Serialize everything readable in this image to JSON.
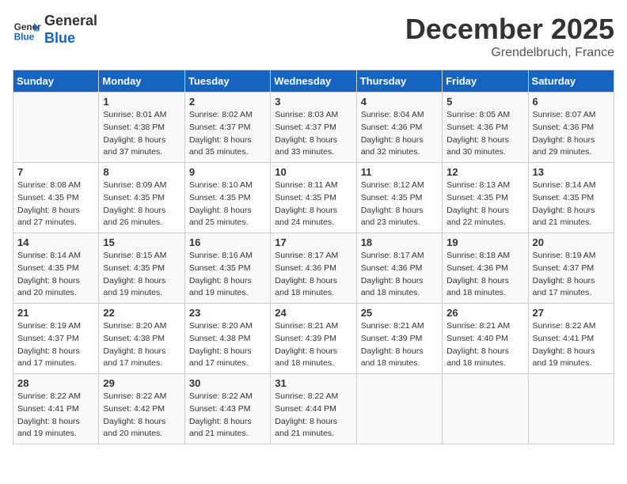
{
  "header": {
    "logo_line1": "General",
    "logo_line2": "Blue",
    "month": "December 2025",
    "location": "Grendelbruch, France"
  },
  "weekdays": [
    "Sunday",
    "Monday",
    "Tuesday",
    "Wednesday",
    "Thursday",
    "Friday",
    "Saturday"
  ],
  "weeks": [
    [
      {
        "day": "",
        "info": ""
      },
      {
        "day": "1",
        "info": "Sunrise: 8:01 AM\nSunset: 4:38 PM\nDaylight: 8 hours\nand 37 minutes."
      },
      {
        "day": "2",
        "info": "Sunrise: 8:02 AM\nSunset: 4:37 PM\nDaylight: 8 hours\nand 35 minutes."
      },
      {
        "day": "3",
        "info": "Sunrise: 8:03 AM\nSunset: 4:37 PM\nDaylight: 8 hours\nand 33 minutes."
      },
      {
        "day": "4",
        "info": "Sunrise: 8:04 AM\nSunset: 4:36 PM\nDaylight: 8 hours\nand 32 minutes."
      },
      {
        "day": "5",
        "info": "Sunrise: 8:05 AM\nSunset: 4:36 PM\nDaylight: 8 hours\nand 30 minutes."
      },
      {
        "day": "6",
        "info": "Sunrise: 8:07 AM\nSunset: 4:36 PM\nDaylight: 8 hours\nand 29 minutes."
      }
    ],
    [
      {
        "day": "7",
        "info": "Sunrise: 8:08 AM\nSunset: 4:35 PM\nDaylight: 8 hours\nand 27 minutes."
      },
      {
        "day": "8",
        "info": "Sunrise: 8:09 AM\nSunset: 4:35 PM\nDaylight: 8 hours\nand 26 minutes."
      },
      {
        "day": "9",
        "info": "Sunrise: 8:10 AM\nSunset: 4:35 PM\nDaylight: 8 hours\nand 25 minutes."
      },
      {
        "day": "10",
        "info": "Sunrise: 8:11 AM\nSunset: 4:35 PM\nDaylight: 8 hours\nand 24 minutes."
      },
      {
        "day": "11",
        "info": "Sunrise: 8:12 AM\nSunset: 4:35 PM\nDaylight: 8 hours\nand 23 minutes."
      },
      {
        "day": "12",
        "info": "Sunrise: 8:13 AM\nSunset: 4:35 PM\nDaylight: 8 hours\nand 22 minutes."
      },
      {
        "day": "13",
        "info": "Sunrise: 8:14 AM\nSunset: 4:35 PM\nDaylight: 8 hours\nand 21 minutes."
      }
    ],
    [
      {
        "day": "14",
        "info": "Sunrise: 8:14 AM\nSunset: 4:35 PM\nDaylight: 8 hours\nand 20 minutes."
      },
      {
        "day": "15",
        "info": "Sunrise: 8:15 AM\nSunset: 4:35 PM\nDaylight: 8 hours\nand 19 minutes."
      },
      {
        "day": "16",
        "info": "Sunrise: 8:16 AM\nSunset: 4:35 PM\nDaylight: 8 hours\nand 19 minutes."
      },
      {
        "day": "17",
        "info": "Sunrise: 8:17 AM\nSunset: 4:36 PM\nDaylight: 8 hours\nand 18 minutes."
      },
      {
        "day": "18",
        "info": "Sunrise: 8:17 AM\nSunset: 4:36 PM\nDaylight: 8 hours\nand 18 minutes."
      },
      {
        "day": "19",
        "info": "Sunrise: 8:18 AM\nSunset: 4:36 PM\nDaylight: 8 hours\nand 18 minutes."
      },
      {
        "day": "20",
        "info": "Sunrise: 8:19 AM\nSunset: 4:37 PM\nDaylight: 8 hours\nand 17 minutes."
      }
    ],
    [
      {
        "day": "21",
        "info": "Sunrise: 8:19 AM\nSunset: 4:37 PM\nDaylight: 8 hours\nand 17 minutes."
      },
      {
        "day": "22",
        "info": "Sunrise: 8:20 AM\nSunset: 4:38 PM\nDaylight: 8 hours\nand 17 minutes."
      },
      {
        "day": "23",
        "info": "Sunrise: 8:20 AM\nSunset: 4:38 PM\nDaylight: 8 hours\nand 17 minutes."
      },
      {
        "day": "24",
        "info": "Sunrise: 8:21 AM\nSunset: 4:39 PM\nDaylight: 8 hours\nand 18 minutes."
      },
      {
        "day": "25",
        "info": "Sunrise: 8:21 AM\nSunset: 4:39 PM\nDaylight: 8 hours\nand 18 minutes."
      },
      {
        "day": "26",
        "info": "Sunrise: 8:21 AM\nSunset: 4:40 PM\nDaylight: 8 hours\nand 18 minutes."
      },
      {
        "day": "27",
        "info": "Sunrise: 8:22 AM\nSunset: 4:41 PM\nDaylight: 8 hours\nand 19 minutes."
      }
    ],
    [
      {
        "day": "28",
        "info": "Sunrise: 8:22 AM\nSunset: 4:41 PM\nDaylight: 8 hours\nand 19 minutes."
      },
      {
        "day": "29",
        "info": "Sunrise: 8:22 AM\nSunset: 4:42 PM\nDaylight: 8 hours\nand 20 minutes."
      },
      {
        "day": "30",
        "info": "Sunrise: 8:22 AM\nSunset: 4:43 PM\nDaylight: 8 hours\nand 21 minutes."
      },
      {
        "day": "31",
        "info": "Sunrise: 8:22 AM\nSunset: 4:44 PM\nDaylight: 8 hours\nand 21 minutes."
      },
      {
        "day": "",
        "info": ""
      },
      {
        "day": "",
        "info": ""
      },
      {
        "day": "",
        "info": ""
      }
    ]
  ]
}
